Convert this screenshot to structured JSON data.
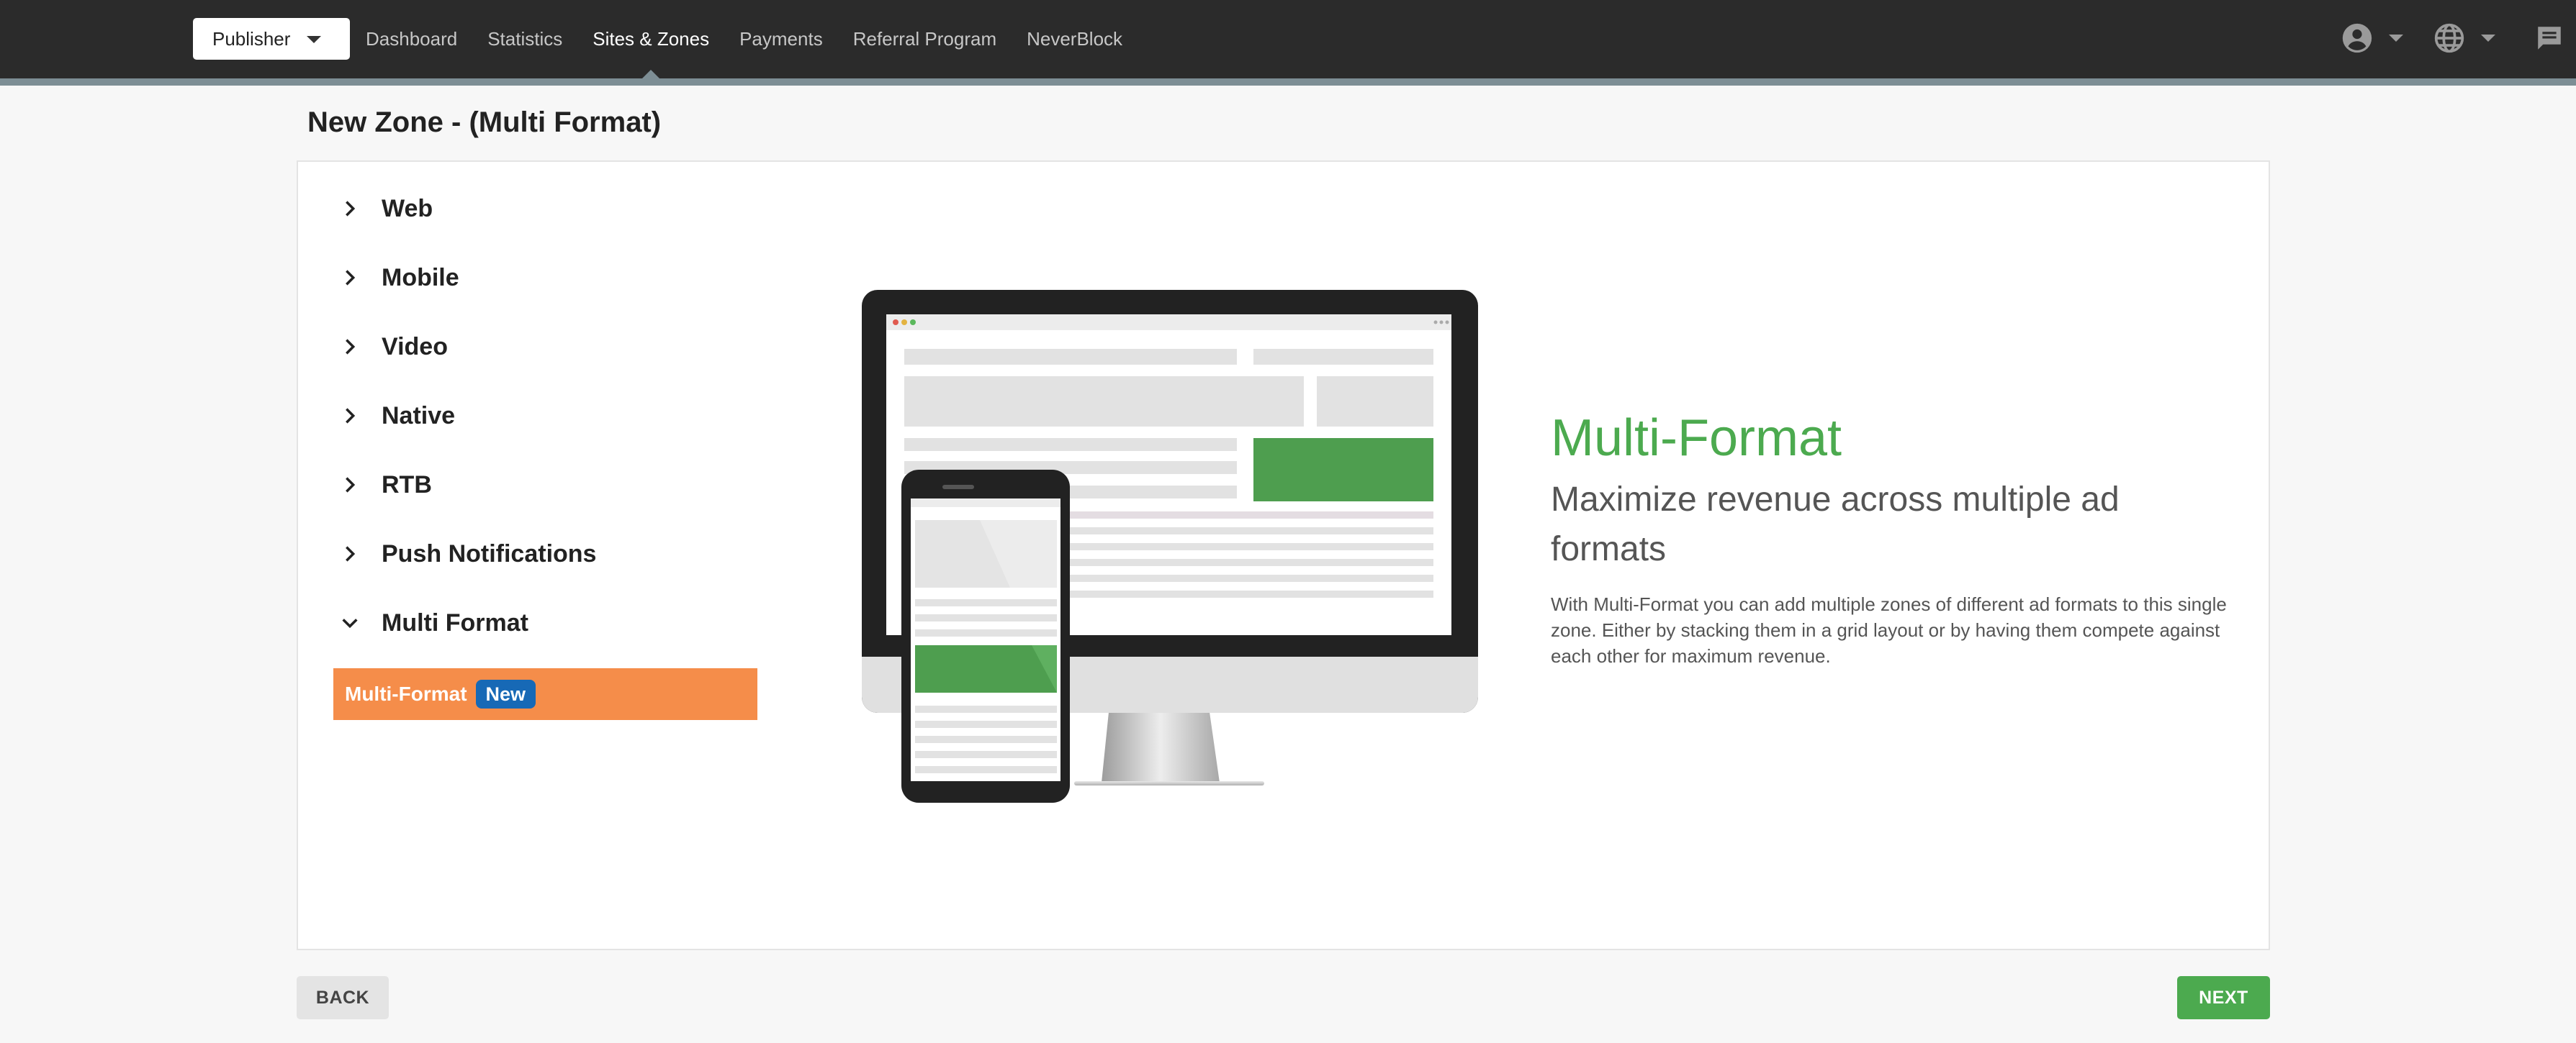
{
  "topbar": {
    "role_select": "Publisher",
    "nav": [
      "Dashboard",
      "Statistics",
      "Sites & Zones",
      "Payments",
      "Referral Program",
      "NeverBlock"
    ],
    "active_nav": "Sites & Zones",
    "icons": [
      "user-account-icon",
      "globe-language-icon",
      "chat-icon"
    ]
  },
  "page": {
    "title": "New Zone - (Multi Format)"
  },
  "categories": [
    {
      "label": "Web",
      "expanded": false
    },
    {
      "label": "Mobile",
      "expanded": false
    },
    {
      "label": "Video",
      "expanded": false
    },
    {
      "label": "Native",
      "expanded": false
    },
    {
      "label": "RTB",
      "expanded": false
    },
    {
      "label": "Push Notifications",
      "expanded": false
    },
    {
      "label": "Multi Format",
      "expanded": true
    }
  ],
  "selected_format": {
    "label": "Multi-Format",
    "badge": "New"
  },
  "info": {
    "title": "Multi-Format",
    "subtitle": "Maximize revenue across multiple ad formats",
    "description": "With Multi-Format you can add multiple zones of different ad formats to this single zone. Either by stacking them in a grid layout or by having them compete against each other for maximum revenue."
  },
  "footer": {
    "back": "BACK",
    "next": "NEXT"
  },
  "colors": {
    "accent_green": "#4caa4f",
    "selected_orange": "#f58d4a",
    "badge_blue": "#1769b6",
    "topbar": "#2b2b2b"
  }
}
